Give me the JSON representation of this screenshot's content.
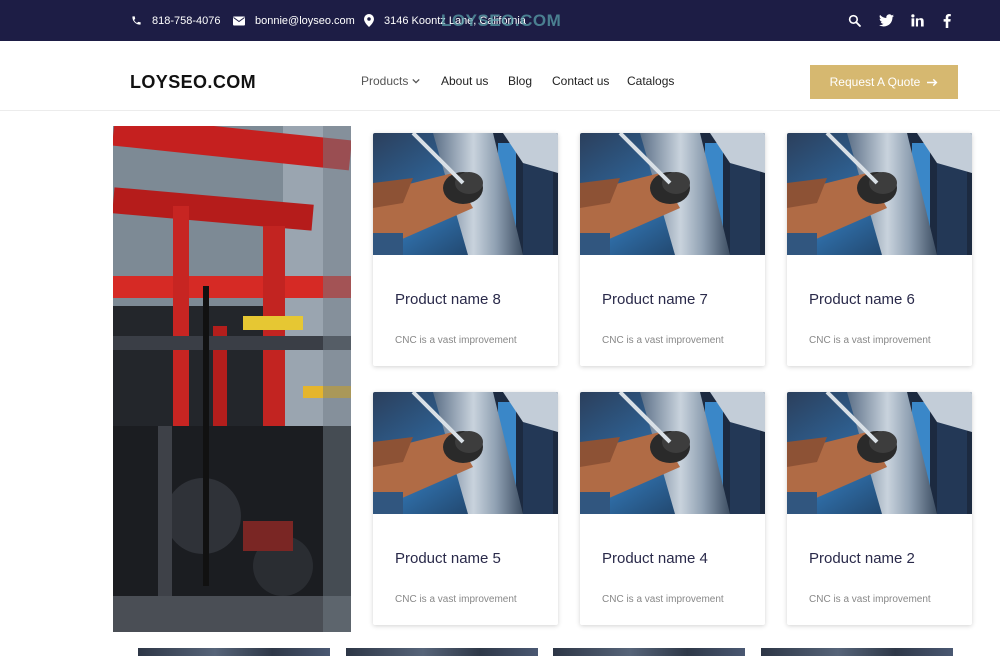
{
  "topbar": {
    "phone": "818-758-4076",
    "email": "bonnie@loyseo.com",
    "address": "3146 Koontz Lane, California",
    "watermark": "LOYSEO.COM",
    "social_icons": [
      "search-icon",
      "twitter-icon",
      "linkedin-icon",
      "facebook-icon"
    ],
    "background": "#1d1d45"
  },
  "header": {
    "logo": "LOYSEO.COM",
    "nav": {
      "products": "Products",
      "about": "About us",
      "blog": "Blog",
      "contact": "Contact us",
      "catalogs": "Catalogs"
    },
    "quote_button": "Request A Quote",
    "accent": "#d6b870"
  },
  "products": [
    {
      "name": "Product name 8",
      "desc": "CNC is a vast improvement"
    },
    {
      "name": "Product name 7",
      "desc": "CNC is a vast improvement"
    },
    {
      "name": "Product name 6",
      "desc": "CNC is a vast improvement"
    },
    {
      "name": "Product name 5",
      "desc": "CNC is a vast improvement"
    },
    {
      "name": "Product name 4",
      "desc": "CNC is a vast improvement"
    },
    {
      "name": "Product name 2",
      "desc": "CNC is a vast improvement"
    }
  ]
}
